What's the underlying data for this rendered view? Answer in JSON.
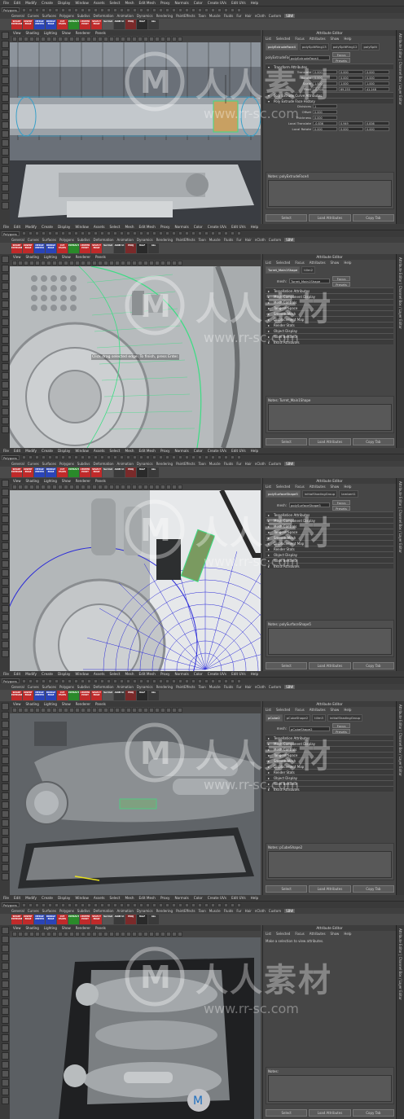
{
  "menu": {
    "items": [
      "File",
      "Edit",
      "Modify",
      "Create",
      "Display",
      "Window",
      "Assets",
      "Select",
      "Mesh",
      "Edit Mesh",
      "Proxy",
      "Normals",
      "Color",
      "Create UVs",
      "Edit UVs",
      "Help"
    ]
  },
  "statusline": {
    "mode": "Polygons"
  },
  "shelf": {
    "tabs": [
      "General",
      "Curves",
      "Surfaces",
      "Polygons",
      "Subdivs",
      "Deformation",
      "Animation",
      "Dynamics",
      "Rendering",
      "PaintEffects",
      "Toon",
      "Muscle",
      "Fluids",
      "Fur",
      "Hair",
      "nCloth",
      "Custom",
      "SBW"
    ],
    "active_tab": "SBW",
    "buttons": [
      {
        "label": "SMART EXTRUDE",
        "color": "#c02a2a"
      },
      {
        "label": "INSERT EDGE",
        "color": "#c02a2a"
      },
      {
        "label": "MERGE VERTEX",
        "color": "#2a44b8"
      },
      {
        "label": "BRIDGE EDGE",
        "color": "#2a44b8"
      },
      {
        "label": "CUT FACES",
        "color": "#c02a2a"
      },
      {
        "label": "EXTRACT",
        "color": "#2a8a2a"
      },
      {
        "label": "CENTER PIVOT",
        "color": "#c02a2a"
      },
      {
        "label": "SELECT EDGE",
        "color": "#c02a2a"
      },
      {
        "label": "Sel Out",
        "color": "#555555"
      },
      {
        "label": "ANIM UI",
        "color": "#3a3a3a"
      },
      {
        "label": "PROJ",
        "color": "#7a2a2a"
      },
      {
        "label": "HALF",
        "color": "#2a2a2a"
      },
      {
        "label": "ALL",
        "color": "#3a3a3a"
      }
    ]
  },
  "viewport_menu": [
    "View",
    "Shading",
    "Lighting",
    "Show",
    "Renderer",
    "Panels"
  ],
  "attribute_editor": {
    "title": "Attribute Editor",
    "menu": [
      "List",
      "Selected",
      "Focus",
      "Attributes",
      "Show",
      "Help"
    ],
    "buttons": {
      "focus": "Focus",
      "presets": "Presets",
      "show": "Show",
      "hide": "Hide",
      "select": "Select",
      "load": "Load Attributes",
      "copy": "Copy Tab"
    }
  },
  "side_tabs": "Attribute Editor | Channel Box / Layer Editor",
  "panels": [
    {
      "tabs": [
        "polyExtrudeFace4",
        "polySplitRing13",
        "polySplitRing12",
        "polySplit"
      ],
      "node_label": "polyExtrudeFace:",
      "node_value": "polyExtrudeFace4",
      "sections": [
        "Transform Attributes"
      ],
      "attrs": [
        {
          "name": "Translate",
          "v": [
            "0.000",
            "0.000",
            "0.000"
          ]
        },
        {
          "name": "Rotate",
          "v": [
            "0.000",
            "0.000",
            "0.000"
          ]
        },
        {
          "name": "Scale",
          "v": [
            "1.000",
            "1.000",
            "1.000"
          ]
        },
        {
          "name": "Pivot",
          "v": [
            "-0.900",
            "69.255",
            "41.248"
          ]
        }
      ],
      "sections2": [
        "Poly Extrude Curve Attributes",
        "Poly Extrude Face History"
      ],
      "attrs2": [
        {
          "name": "Divisions",
          "v": [
            "1"
          ]
        },
        {
          "name": "Offset",
          "v": [
            "0.000"
          ]
        },
        {
          "name": "Thickness",
          "v": [
            "0.000"
          ]
        },
        {
          "name": "Local Translate",
          "v": [
            "-0.836",
            "0.949",
            "0.836"
          ]
        },
        {
          "name": "Local Rotate",
          "v": [
            "0.000",
            "0.000",
            "0.000"
          ]
        }
      ],
      "notes": "Notes: polyExtrudeFace4",
      "message": ""
    },
    {
      "tabs": [
        "Turret_Main1Shape",
        "tillm2"
      ],
      "node_label": "mesh:",
      "node_value": "Turret_Main1Shape",
      "sections": [
        "Tessellation Attributes",
        "Mesh Component Display",
        "Mesh Controls",
        "Tangent Space",
        "Smooth Mesh",
        "Displacement Map",
        "Render Stats",
        "Object Display",
        "Node Behavior",
        "Extra Attributes"
      ],
      "attrs": [],
      "sections2": [],
      "attrs2": [],
      "notes": "Notes: Turret_Main1Shape",
      "hud": "Click drag selected edge. To finish, press Enter.",
      "message": ""
    },
    {
      "tabs": [
        "polySurfaceShape5",
        "initialShadingGroup",
        "lambert1"
      ],
      "node_label": "mesh:",
      "node_value": "polySurfaceShape5",
      "sections": [
        "Tessellation Attributes",
        "Mesh Component Display",
        "Mesh Controls",
        "Tangent Space",
        "Smooth Mesh",
        "Displacement Map",
        "Render Stats",
        "Object Display",
        "Node Behavior",
        "Extra Attributes"
      ],
      "attrs": [],
      "sections2": [],
      "attrs2": [],
      "notes": "Notes: polySurfaceShape5",
      "message": ""
    },
    {
      "tabs": [
        "pCube2",
        "pCubeShape2",
        "tillm3",
        "initialShadingGroup"
      ],
      "node_label": "mesh:",
      "node_value": "pCubeShape2",
      "sections": [
        "Tessellation Attributes",
        "Mesh Component Display",
        "Mesh Controls",
        "Tangent Space",
        "Smooth Mesh",
        "Displacement Map",
        "Render Stats",
        "Object Display",
        "Node Behavior",
        "Extra Attributes"
      ],
      "attrs": [],
      "sections2": [],
      "attrs2": [],
      "notes": "Notes: pCubeShape2",
      "message": ""
    },
    {
      "tabs": [],
      "node_label": "",
      "node_value": "",
      "sections": [],
      "attrs": [],
      "sections2": [],
      "attrs2": [],
      "notes": "Notes:",
      "message": "Make a selection to view attributes."
    }
  ],
  "watermark": {
    "text_cn": "人人素材",
    "url": "www.rr-sc.com"
  },
  "colors": {
    "accent_green": "#3ddc84",
    "wire_blue": "#2a2ad8",
    "bg_dark": "#2b2b2b"
  }
}
